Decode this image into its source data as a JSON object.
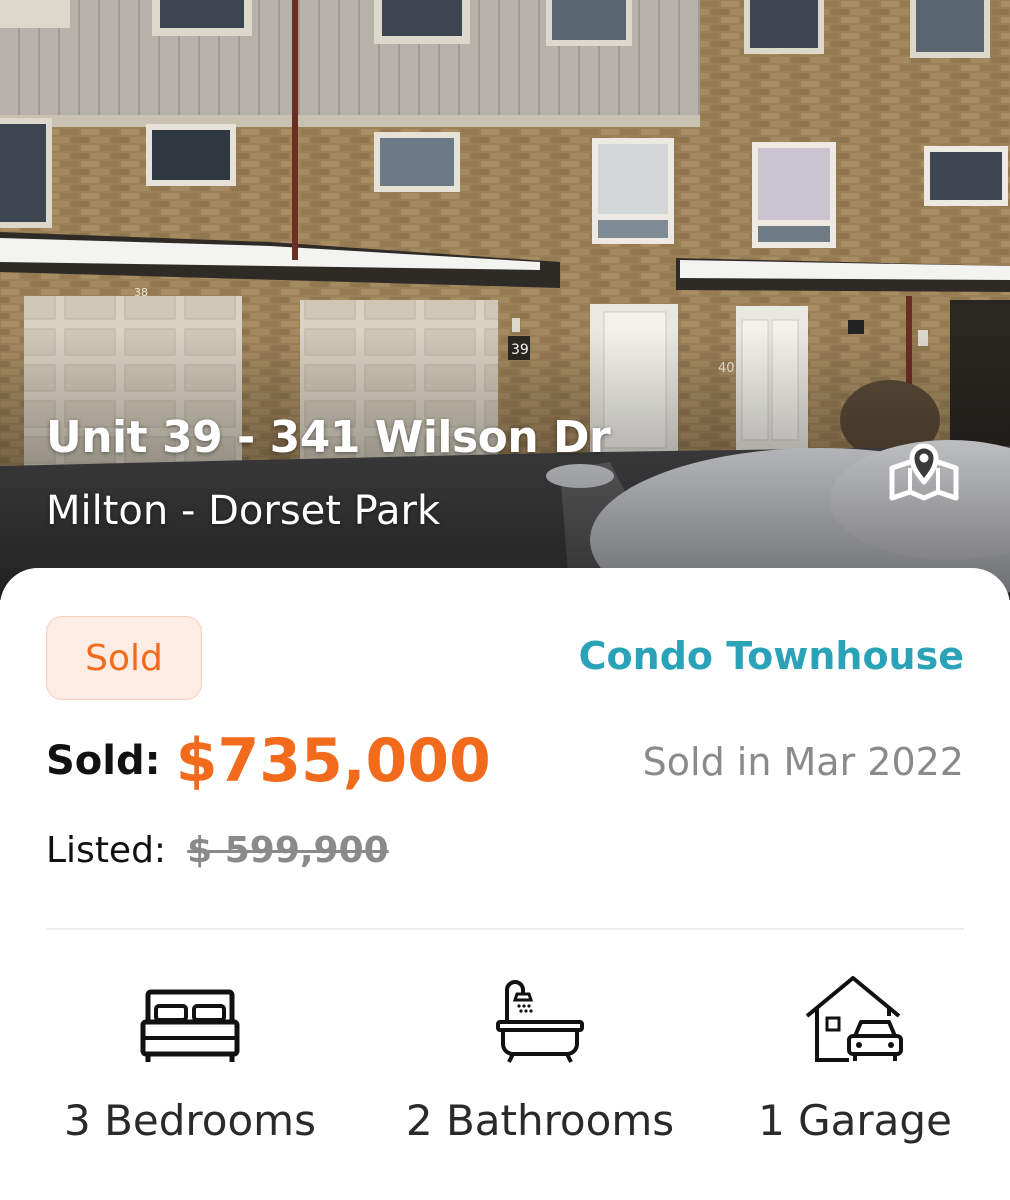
{
  "listing": {
    "address": "Unit 39 - 341 Wilson Dr",
    "area": "Milton - Dorset Park",
    "status": "Sold",
    "property_type": "Condo Townhouse",
    "sold_label": "Sold:",
    "sold_price": "$735,000",
    "sold_date": "Sold in Mar 2022",
    "listed_label": "Listed:",
    "listed_price": "$ 599,900"
  },
  "hero": {
    "unit_numbers": [
      "39",
      "40",
      "38"
    ]
  },
  "features": [
    {
      "icon": "bed-icon",
      "label": "3 Bedrooms"
    },
    {
      "icon": "bathtub-icon",
      "label": "2 Bathrooms"
    },
    {
      "icon": "garage-icon",
      "label": "1 Garage"
    }
  ],
  "colors": {
    "accent_orange": "#f26a1b",
    "type_teal": "#2aa3b8",
    "muted_gray": "#8a8a8a"
  }
}
